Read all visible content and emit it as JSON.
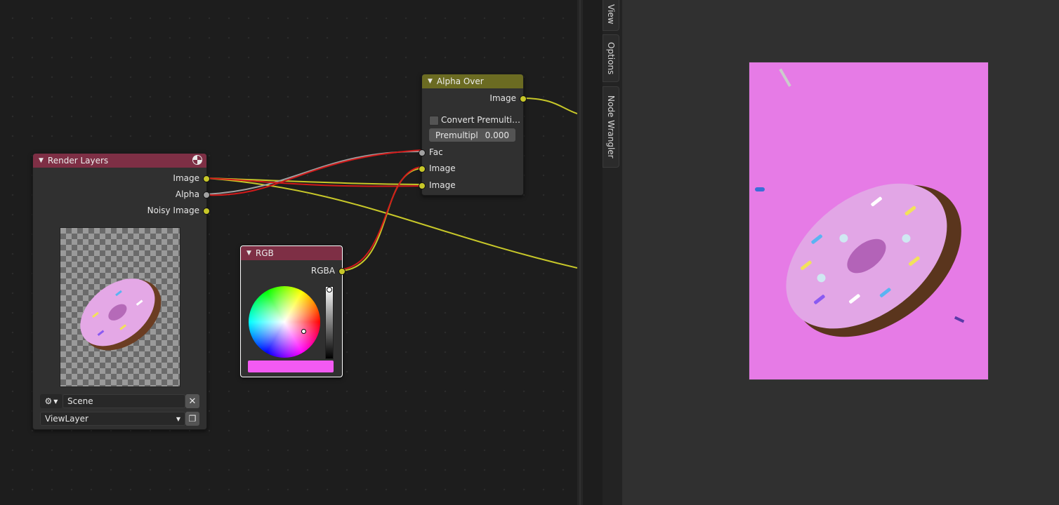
{
  "colors": {
    "render_layers_header": "#7e2f45",
    "rgb_header": "#7e2f45",
    "alpha_over_header": "#6b6b22",
    "socket_yellow": "#c7c729",
    "socket_grey": "#a1a1a1",
    "swatch": "#f35af3",
    "render_background": "#e67be6"
  },
  "sidebar": {
    "tabs": [
      "View",
      "Options",
      "Node Wrangler"
    ]
  },
  "nodes": {
    "render_layers": {
      "title": "Render Layers",
      "outputs": [
        "Image",
        "Alpha",
        "Noisy Image"
      ],
      "scene": "Scene",
      "view_layer": "ViewLayer",
      "icons": [
        "render-layer-icon",
        "scene-icon",
        "close-icon",
        "chevron-down-icon",
        "copy-icon"
      ]
    },
    "rgb": {
      "title": "RGB",
      "output": "RGBA"
    },
    "alpha_over": {
      "title": "Alpha Over",
      "output": "Image",
      "convert_label": "Convert Premulti…",
      "convert_checked": false,
      "premul_label": "Premultipl",
      "premul_value": "0.000",
      "inputs": [
        "Fac",
        "Image",
        "Image"
      ]
    }
  }
}
